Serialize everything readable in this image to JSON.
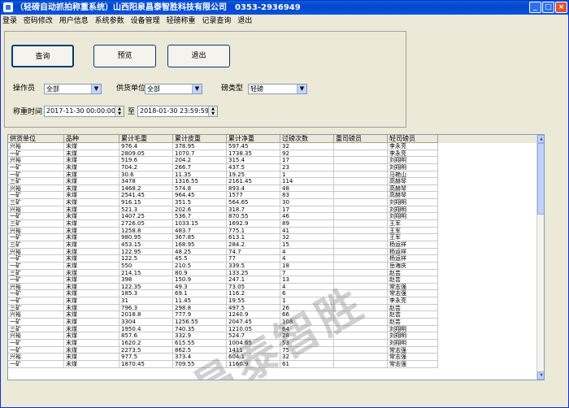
{
  "window": {
    "title": "（轻磅自动抓拍称重系统）山西阳泉昌泰智胜科技有限公司　0353-2936949",
    "min": "_",
    "max": "□",
    "close": "×"
  },
  "menu": [
    "登录",
    "密码修改",
    "用户信息",
    "系统参数",
    "设备管理",
    "轻磅称重",
    "记录查询",
    "退出"
  ],
  "buttons": {
    "query": "查询",
    "preview": "预览",
    "exit": "退出"
  },
  "filters": {
    "operator_label": "操作员",
    "operator_value": "全部",
    "supplier_label": "供货单位",
    "supplier_value": "全部",
    "scale_type_label": "磅类型",
    "scale_type_value": "轻磅",
    "weigh_time_label": "称重时间",
    "time_from": "2017-11-30 00:00:00",
    "time_sep": "至",
    "time_to": "2018-01-30 23:59:59"
  },
  "table": {
    "columns": [
      "供货单位",
      "品种",
      "累计毛重",
      "累计皮重",
      "累计净重",
      "过磅次数",
      "重司磅员",
      "轻司磅员"
    ],
    "rows": [
      [
        "兴裕",
        "末煤",
        "976.4",
        "378.95",
        "597.45",
        "32",
        "",
        "李永亮"
      ],
      [
        "一矿",
        "末煤",
        "2809.05",
        "1070.7",
        "1738.35",
        "92",
        "",
        "李永亮"
      ],
      [
        "兴裕",
        "末煤",
        "519.6",
        "204.2",
        "315.4",
        "17",
        "",
        "刘翔明"
      ],
      [
        "一矿",
        "末煤",
        "704.2",
        "266.7",
        "437.5",
        "23",
        "",
        "刘翔明"
      ],
      [
        "一矿",
        "末煤",
        "30.6",
        "11.35",
        "19.25",
        "1",
        "",
        "马艳山"
      ],
      [
        "三矿",
        "末煤",
        "3478",
        "1316.55",
        "2161.45",
        "114",
        "",
        "高赫琴"
      ],
      [
        "兴裕",
        "末煤",
        "1468.2",
        "574.8",
        "893.4",
        "48",
        "",
        "高赫琴"
      ],
      [
        "一矿",
        "末煤",
        "2541.45",
        "964.45",
        "1577",
        "83",
        "",
        "高赫琴"
      ],
      [
        "三矿",
        "末煤",
        "916.15",
        "351.5",
        "564.65",
        "30",
        "",
        "刘翔明"
      ],
      [
        "兴裕",
        "末煤",
        "521.3",
        "202.6",
        "318.7",
        "17",
        "",
        "刘翔明"
      ],
      [
        "一矿",
        "末煤",
        "1407.25",
        "536.7",
        "870.55",
        "46",
        "",
        "刘翔明"
      ],
      [
        "三矿",
        "末煤",
        "2726.05",
        "1033.15",
        "1692.9",
        "89",
        "",
        "王军"
      ],
      [
        "兴裕",
        "末煤",
        "1258.8",
        "483.7",
        "775.1",
        "41",
        "",
        "王军"
      ],
      [
        "一矿",
        "末煤",
        "980.95",
        "367.85",
        "613.1",
        "32",
        "",
        "王军"
      ],
      [
        "三矿",
        "末煤",
        "453.15",
        "168.95",
        "284.2",
        "15",
        "",
        "杨运祥"
      ],
      [
        "兴裕",
        "末煤",
        "122.95",
        "48.25",
        "74.7",
        "4",
        "",
        "杨运祥"
      ],
      [
        "一矿",
        "末煤",
        "122.5",
        "45.5",
        "77",
        "4",
        "",
        "杨运祥"
      ],
      [
        "一矿",
        "末煤",
        "550",
        "210.5",
        "339.5",
        "18",
        "",
        "岳海庆"
      ],
      [
        "三矿",
        "末煤",
        "214.15",
        "80.9",
        "133.25",
        "7",
        "",
        "赵芸"
      ],
      [
        "一矿",
        "末煤",
        "398",
        "150.9",
        "247.1",
        "13",
        "",
        "赵芸"
      ],
      [
        "兴裕",
        "末煤",
        "122.35",
        "49.3",
        "73.05",
        "4",
        "",
        "常志强"
      ],
      [
        "一矿",
        "末煤",
        "185.3",
        "69.1",
        "116.2",
        "6",
        "",
        "常志强"
      ],
      [
        "一矿",
        "末煤",
        "31",
        "11.45",
        "19.55",
        "1",
        "",
        "李永亮"
      ],
      [
        "三矿",
        "末煤",
        "796.3",
        "298.8",
        "497.5",
        "26",
        "",
        "赵芸"
      ],
      [
        "兴裕",
        "末煤",
        "2018.8",
        "777.9",
        "1240.9",
        "66",
        "",
        "赵芸"
      ],
      [
        "一矿",
        "末煤",
        "3304",
        "1256.55",
        "2047.45",
        "108",
        "",
        "赵芸"
      ],
      [
        "三矿",
        "末煤",
        "1950.4",
        "740.35",
        "1210.05",
        "64",
        "",
        "刘翔明"
      ],
      [
        "兴裕",
        "末煤",
        "857.6",
        "332.9",
        "524.7",
        "28",
        "",
        "刘翔明"
      ],
      [
        "一矿",
        "末煤",
        "1620.2",
        "615.55",
        "1004.65",
        "53",
        "",
        "刘翔明"
      ],
      [
        "一矿",
        "末煤",
        "2273.5",
        "862.5",
        "1411",
        "75",
        "",
        "常志强"
      ],
      [
        "兴裕",
        "末煤",
        "977.5",
        "373.4",
        "604.1",
        "32",
        "",
        "常志强"
      ],
      [
        "一矿",
        "末煤",
        "1870.45",
        "709.55",
        "1160.9",
        "61",
        "",
        "常志强"
      ]
    ]
  },
  "watermark": "昌泰智胜"
}
